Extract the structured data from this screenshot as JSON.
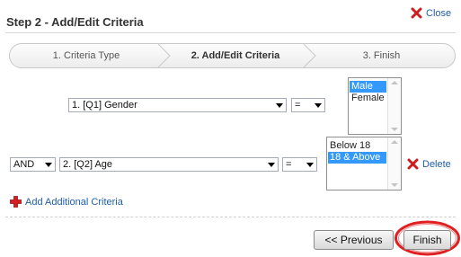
{
  "dialog": {
    "title": "Step 2 - Add/Edit Criteria",
    "close_label": "Close"
  },
  "wizard": {
    "steps": [
      {
        "label": "1. Criteria Type",
        "active": false
      },
      {
        "label": "2. Add/Edit Criteria",
        "active": true
      },
      {
        "label": "3. Finish",
        "active": false
      }
    ]
  },
  "criteria": [
    {
      "connector": "",
      "question": "1. [Q1] Gender",
      "operator": "=",
      "values": [
        {
          "label": "Male",
          "selected": true
        },
        {
          "label": "Female",
          "selected": false
        }
      ]
    },
    {
      "connector": "AND",
      "question": "2. [Q2] Age",
      "operator": "=",
      "values": [
        {
          "label": "Below 18",
          "selected": false
        },
        {
          "label": "18 & Above",
          "selected": true
        }
      ],
      "delete_label": "Delete"
    }
  ],
  "add_criteria_label": "Add Additional Criteria",
  "buttons": {
    "previous": "<< Previous",
    "finish": "Finish"
  },
  "colors": {
    "link": "#1f5ea8",
    "selection": "#3399ff",
    "highlight_ring": "#e02020",
    "close_icon": "#cc1e1e",
    "add_icon": "#d42020"
  }
}
